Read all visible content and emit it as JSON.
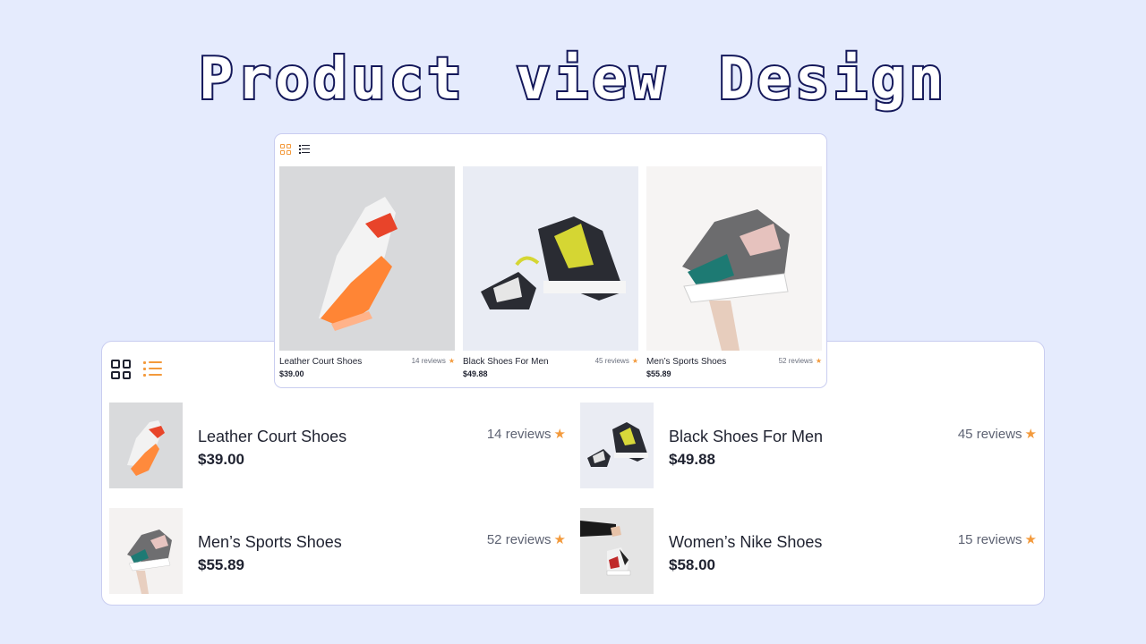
{
  "title": "Product view  Design",
  "colors": {
    "background": "#e5ebfd",
    "accent": "#f39a3c",
    "title_outline": "#14185a",
    "card_border": "#c9cdf0"
  },
  "view_toggle": {
    "grid_icon": "grid-icon",
    "list_icon": "list-icon"
  },
  "grid_view": {
    "active": "grid",
    "products": [
      {
        "name": "Leather Court Shoes",
        "price": "$39.00",
        "reviews": "14 reviews",
        "star": "★"
      },
      {
        "name": "Black Shoes For Men",
        "price": "$49.88",
        "reviews": "45 reviews",
        "star": "★"
      },
      {
        "name": "Men’s Sports Shoes",
        "price": "$55.89",
        "reviews": "52 reviews",
        "star": "★"
      }
    ]
  },
  "list_view": {
    "active": "list",
    "products": [
      {
        "name": "Leather Court Shoes",
        "price": "$39.00",
        "reviews": "14 reviews",
        "star": "★"
      },
      {
        "name": "Black Shoes For Men",
        "price": "$49.88",
        "reviews": "45 reviews",
        "star": "★"
      },
      {
        "name": "Men’s Sports Shoes",
        "price": "$55.89",
        "reviews": "52 reviews",
        "star": "★"
      },
      {
        "name": "Women’s Nike Shoes",
        "price": "$58.00",
        "reviews": "15 reviews",
        "star": "★"
      }
    ]
  }
}
